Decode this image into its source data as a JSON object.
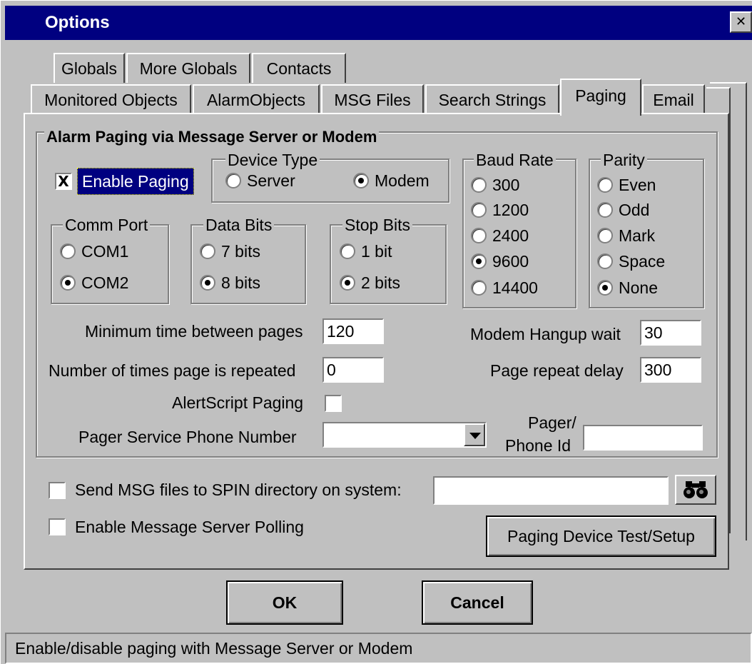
{
  "window": {
    "title": "Options",
    "close_glyph": "✕"
  },
  "tabs": {
    "row1": [
      "Globals",
      "More Globals",
      "Contacts"
    ],
    "row2": [
      "Monitored Objects",
      "AlarmObjects",
      "MSG Files",
      "Search Strings",
      "Paging",
      "Email"
    ],
    "active": "Paging"
  },
  "paging": {
    "group_title": "Alarm Paging via Message Server or Modem",
    "enable_paging": {
      "label": "Enable Paging",
      "checked": true,
      "mark": "X"
    },
    "device_type": {
      "title": "Device Type",
      "options": [
        "Server",
        "Modem"
      ],
      "selected": "Modem"
    },
    "baud_rate": {
      "title": "Baud Rate",
      "options": [
        "300",
        "1200",
        "2400",
        "9600",
        "14400"
      ],
      "selected": "9600"
    },
    "parity": {
      "title": "Parity",
      "options": [
        "Even",
        "Odd",
        "Mark",
        "Space",
        "None"
      ],
      "selected": "None"
    },
    "comm_port": {
      "title": "Comm Port",
      "options": [
        "COM1",
        "COM2"
      ],
      "selected": "COM2"
    },
    "data_bits": {
      "title": "Data Bits",
      "options": [
        "7 bits",
        "8 bits"
      ],
      "selected": "8 bits"
    },
    "stop_bits": {
      "title": "Stop Bits",
      "options": [
        "1 bit",
        "2 bits"
      ],
      "selected": "2 bits"
    },
    "min_time": {
      "label": "Minimum time between pages",
      "value": "120"
    },
    "repeat_count": {
      "label": "Number of times page is repeated",
      "value": "0"
    },
    "alertscript": {
      "label": "AlertScript Paging",
      "checked": false
    },
    "phone_number": {
      "label": "Pager Service Phone Number",
      "value": ""
    },
    "hangup_wait": {
      "label": "Modem Hangup wait",
      "value": "30"
    },
    "repeat_delay": {
      "label": "Page repeat delay",
      "value": "300"
    },
    "pager_id": {
      "label_line1": "Pager/",
      "label_line2": "Phone Id",
      "value": ""
    }
  },
  "spin": {
    "label": "Send MSG files to SPIN directory on system:",
    "checked": false,
    "value": ""
  },
  "polling": {
    "label": "Enable Message Server Polling",
    "checked": false
  },
  "test_button": "Paging Device Test/Setup",
  "buttons": {
    "ok": "OK",
    "cancel": "Cancel"
  },
  "status_bar": "Enable/disable paging with Message Server or Modem",
  "colors": {
    "title_bar": "#000080",
    "selection": "#000080",
    "face": "#c0c0c0"
  }
}
